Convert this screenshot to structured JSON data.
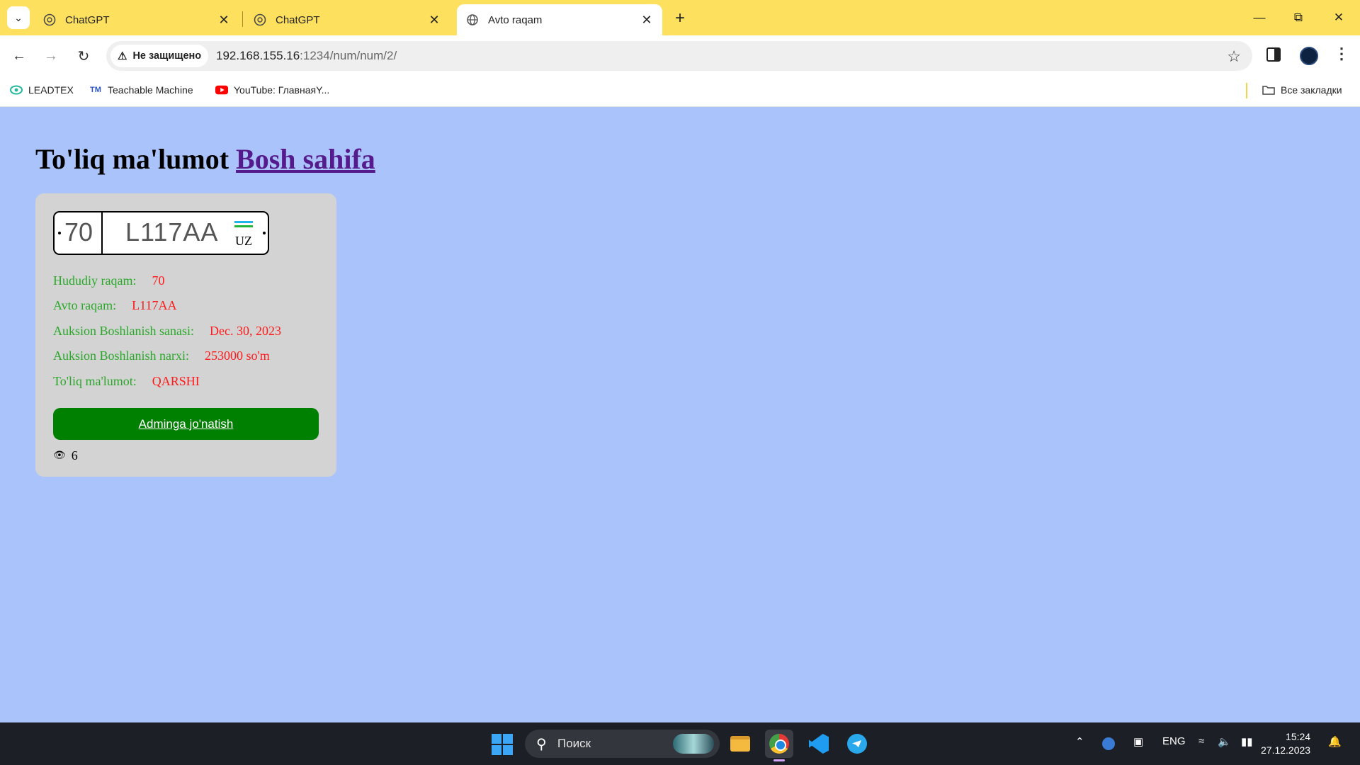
{
  "browser": {
    "tabs": [
      {
        "title": "ChatGPT",
        "icon": "chatgpt-icon",
        "active": false
      },
      {
        "title": "ChatGPT",
        "icon": "chatgpt-icon",
        "active": false
      },
      {
        "title": "Avto raqam",
        "icon": "globe-icon",
        "active": true
      }
    ],
    "security_label": "Не защищено",
    "url_host": "192.168.155.16",
    "url_path": ":1234/num/num/2/",
    "bookmarks": [
      {
        "label": "LEADTEX",
        "icon": "leadtex-icon"
      },
      {
        "label": "Teachable Machine",
        "icon": "teachable-machine-icon",
        "icon_text": "TM"
      },
      {
        "label": "YouTube: ГлавнаяY...",
        "icon": "youtube-icon"
      }
    ],
    "all_bookmarks_label": "Все закладки"
  },
  "page": {
    "heading": "To'liq ma'lumot",
    "home_link": "Bosh sahifa",
    "plate": {
      "region": "70",
      "number": "L117AA",
      "country": "UZ",
      "flag_colors": [
        "#1eb5e8",
        "#ffffff",
        "#1eb53a"
      ]
    },
    "details": [
      {
        "label": "Hududiy raqam:",
        "value": "70"
      },
      {
        "label": "Avto raqam:",
        "value": "L117AA"
      },
      {
        "label": "Auksion Boshlanish sanasi:",
        "value": "Dec. 30, 2023"
      },
      {
        "label": "Auksion Boshlanish narxi:",
        "value": "253000 so'm"
      },
      {
        "label": "To'liq ma'lumot:",
        "value": "QARSHI"
      }
    ],
    "admin_button": "Adminga jo'natish",
    "views": "6"
  },
  "taskbar": {
    "search_placeholder": "Поиск",
    "language": "ENG",
    "time": "15:24",
    "date": "27.12.2023"
  },
  "colors": {
    "page_bg": "#aac4fb",
    "card_bg": "#d3d3d3",
    "label_green": "#2aa82a",
    "value_red": "#ff1a1a",
    "button_green": "#008000",
    "tabstrip": "#fde05e"
  }
}
